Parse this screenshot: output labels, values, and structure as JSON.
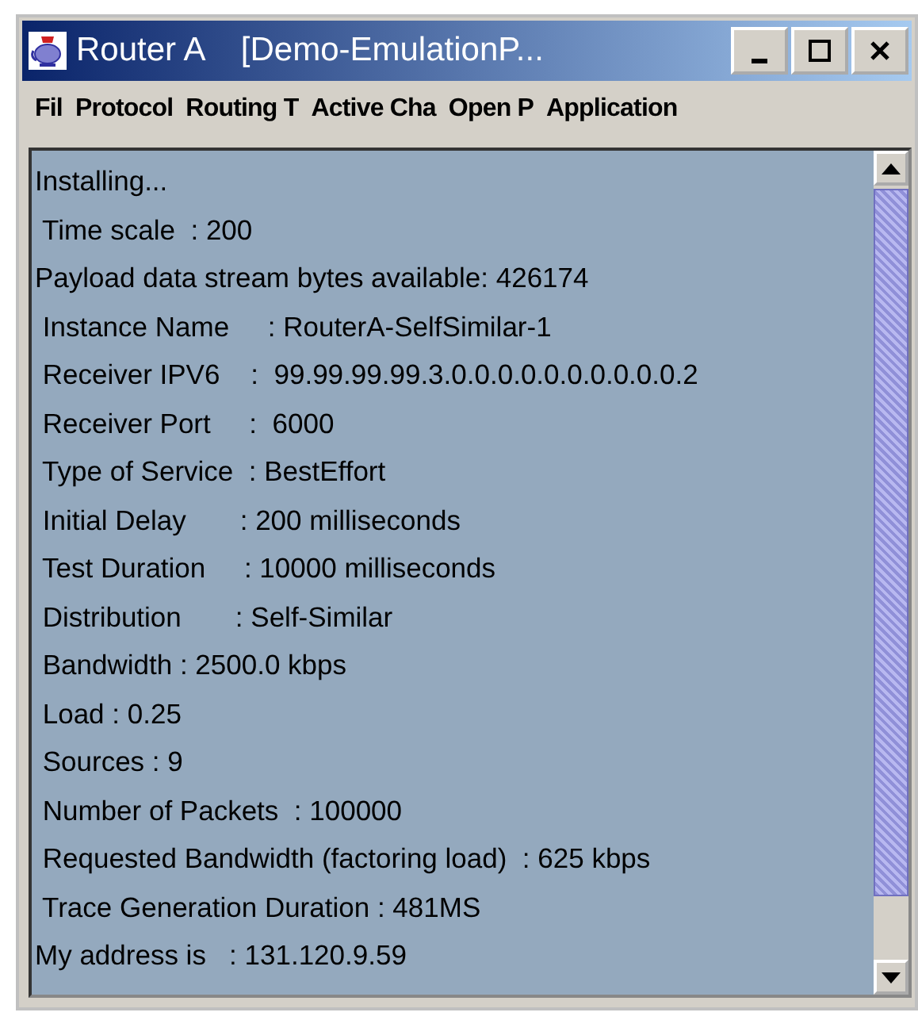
{
  "window": {
    "title": "Router A    [Demo-EmulationP..."
  },
  "menu": [
    "Fil",
    "Protocol",
    "Routing T",
    "Active Cha",
    "Open P",
    "Application"
  ],
  "log_lines": [
    "Installing...",
    " Time scale  : 200",
    "Payload data stream bytes available: 426174",
    " Instance Name     : RouterA-SelfSimilar-1",
    " Receiver IPV6    :  99.99.99.99.3.0.0.0.0.0.0.0.0.0.0.2",
    " Receiver Port     :  6000",
    " Type of Service  : BestEffort",
    " Initial Delay       : 200 milliseconds",
    " Test Duration     : 10000 milliseconds",
    " Distribution       : Self-Similar",
    " Bandwidth : 2500.0 kbps",
    " Load : 0.25",
    " Sources : 9",
    " Number of Packets  : 100000",
    " Requested Bandwidth (factoring load)  : 625 kbps",
    " Trace Generation Duration : 481MS",
    "My address is   : 131.120.9.59"
  ]
}
